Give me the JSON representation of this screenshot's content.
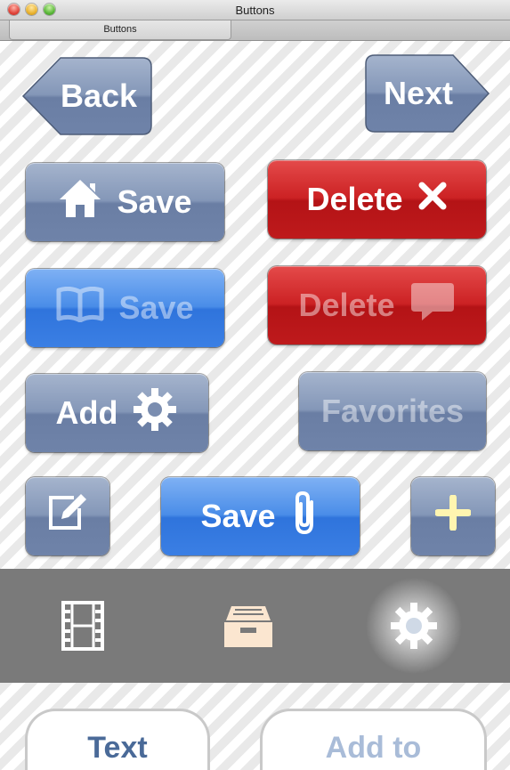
{
  "window": {
    "title": "Buttons"
  },
  "tab": {
    "label": "Buttons"
  },
  "buttons": {
    "back": "Back",
    "next": "Next",
    "save_home": "Save",
    "delete_x": "Delete",
    "save_book": "Save",
    "delete_chat": "Delete",
    "add_gear": "Add",
    "favorites": "Favorites",
    "save_clip": "Save"
  },
  "bottom_tabs": {
    "text": "Text",
    "add_to": "Add to"
  },
  "toolbar": {
    "items": [
      "film-icon",
      "inbox-icon",
      "gear-icon"
    ],
    "selected": "gear-icon"
  },
  "colors": {
    "steel": "#7a8db0",
    "red": "#c01a1c",
    "blue": "#3a7fe4",
    "toolbar_bg": "#7a7a7a"
  }
}
